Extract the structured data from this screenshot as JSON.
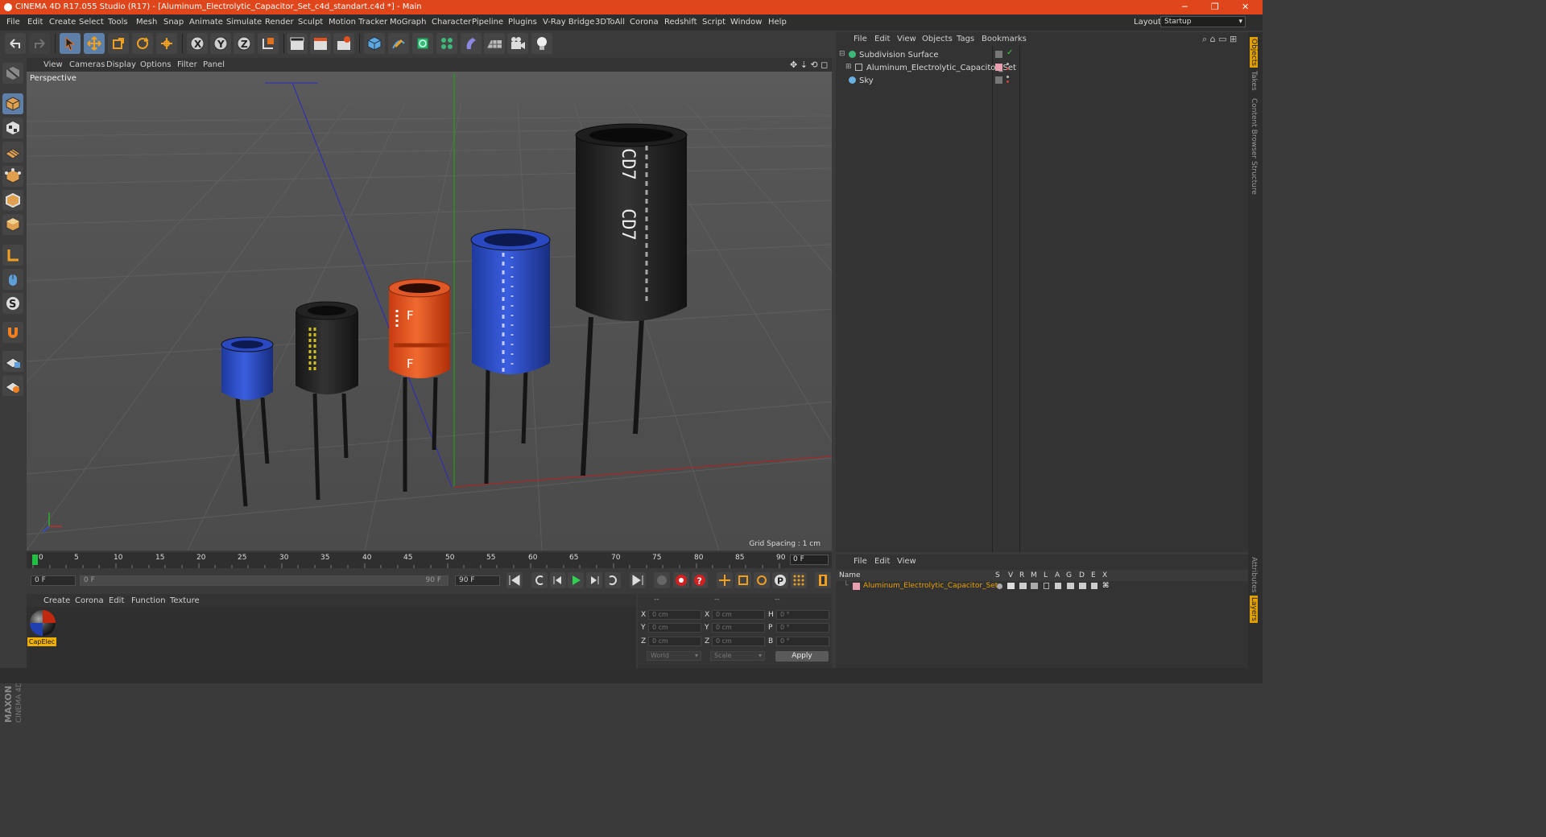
{
  "window": {
    "title": "CINEMA 4D R17.055 Studio (R17) - [Aluminum_Electrolytic_Capacitor_Set_c4d_standart.c4d *] - Main",
    "minimize_label": "─",
    "maximize_label": "❐",
    "close_label": "✕"
  },
  "menubar": {
    "items": [
      "File",
      "Edit",
      "Create",
      "Select",
      "Tools",
      "Mesh",
      "Snap",
      "Animate",
      "Simulate",
      "Render",
      "Sculpt",
      "Motion Tracker",
      "MoGraph",
      "Character",
      "Pipeline",
      "Plugins",
      "V-Ray Bridge",
      "3DToAll",
      "Corona",
      "Redshift",
      "Script",
      "Window",
      "Help"
    ],
    "layout_label": "Layout:",
    "layout_value": "Startup"
  },
  "toolbar": {
    "axis_x": "X",
    "axis_y": "Y",
    "axis_z": "Z"
  },
  "viewport": {
    "menu": [
      "View",
      "Cameras",
      "Display",
      "Options",
      "Filter",
      "Panel"
    ],
    "label": "Perspective",
    "grid_spacing": "Grid Spacing : 1 cm",
    "capacitor_marks": [
      "F",
      "F",
      "CD7",
      "CD7"
    ]
  },
  "timeline": {
    "ticks": [
      "0",
      "5",
      "10",
      "15",
      "20",
      "25",
      "30",
      "35",
      "40",
      "45",
      "50",
      "55",
      "60",
      "65",
      "70",
      "75",
      "80",
      "85",
      "90"
    ],
    "current_frame": "0 F"
  },
  "playback": {
    "start_field": "0 F",
    "range_start": "0 F",
    "range_end": "90 F",
    "end_field": "90 F"
  },
  "material_manager": {
    "menu": [
      "Create",
      "Corona",
      "Edit",
      "Function",
      "Texture"
    ],
    "material_name": "CapElec"
  },
  "coordinates": {
    "headers": [
      "--",
      "--",
      "--"
    ],
    "rows": [
      {
        "a": "X",
        "av": "0 cm",
        "b": "X",
        "bv": "0 cm",
        "c": "H",
        "cv": "0 °"
      },
      {
        "a": "Y",
        "av": "0 cm",
        "b": "Y",
        "bv": "0 cm",
        "c": "P",
        "cv": "0 °"
      },
      {
        "a": "Z",
        "av": "0 cm",
        "b": "Z",
        "bv": "0 cm",
        "c": "B",
        "cv": "0 °"
      }
    ],
    "space": "World",
    "mode": "Scale",
    "apply": "Apply"
  },
  "object_manager": {
    "menu": [
      "File",
      "Edit",
      "View",
      "Objects",
      "Tags",
      "Bookmarks"
    ],
    "objects": [
      {
        "name": "Subdivision Surface"
      },
      {
        "name": "Aluminum_Electrolytic_Capacitor_Set"
      },
      {
        "name": "Sky"
      }
    ]
  },
  "layer_manager": {
    "menu": [
      "File",
      "Edit",
      "View"
    ],
    "headers": [
      "Name",
      "S",
      "V",
      "R",
      "M",
      "L",
      "A",
      "G",
      "D",
      "E",
      "X"
    ],
    "layer_name": "Aluminum_Electrolytic_Capacitor_Set"
  },
  "right_tabs": [
    "Objects",
    "Takes",
    "Content Browser",
    "Structure",
    "Attributes",
    "Layers"
  ],
  "maxon": {
    "brand": "MAXON",
    "product": "CINEMA 4D"
  },
  "colors": {
    "title_bar": "#e0461b",
    "accent_blue": "#5e7fa8",
    "material_tag": "#f0b000",
    "layer_orange": "#e8a000"
  }
}
